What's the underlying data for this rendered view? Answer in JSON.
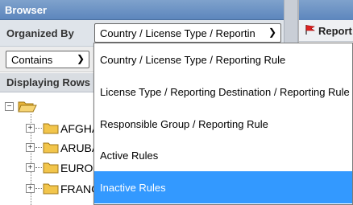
{
  "browser": {
    "title": "Browser",
    "organized_by_label": "Organized By",
    "organized_by_value": "Country / License Type / Reporting Rule",
    "organized_by_display": "Country / License Type / Reportin",
    "filter_mode": "Contains",
    "displaying_label": "Displaying Rows",
    "tree": {
      "nodes": [
        {
          "label": "AFGHA"
        },
        {
          "label": "ARUBA"
        },
        {
          "label": "EUROF"
        },
        {
          "label": "FRANC"
        }
      ]
    }
  },
  "right_panel": {
    "label": "Report"
  },
  "dropdown": {
    "options": [
      {
        "label": "Country / License Type / Reporting Rule"
      },
      {
        "label": "License Type / Reporting Destination / Reporting Rule"
      },
      {
        "label": "Responsible Group / Reporting Rule"
      },
      {
        "label": "Active Rules"
      },
      {
        "label": "Inactive Rules"
      }
    ],
    "highlighted": "Inactive Rules"
  },
  "colors": {
    "header": "#5d86bd",
    "highlight": "#3399ff",
    "folder": "#f2c54b"
  }
}
